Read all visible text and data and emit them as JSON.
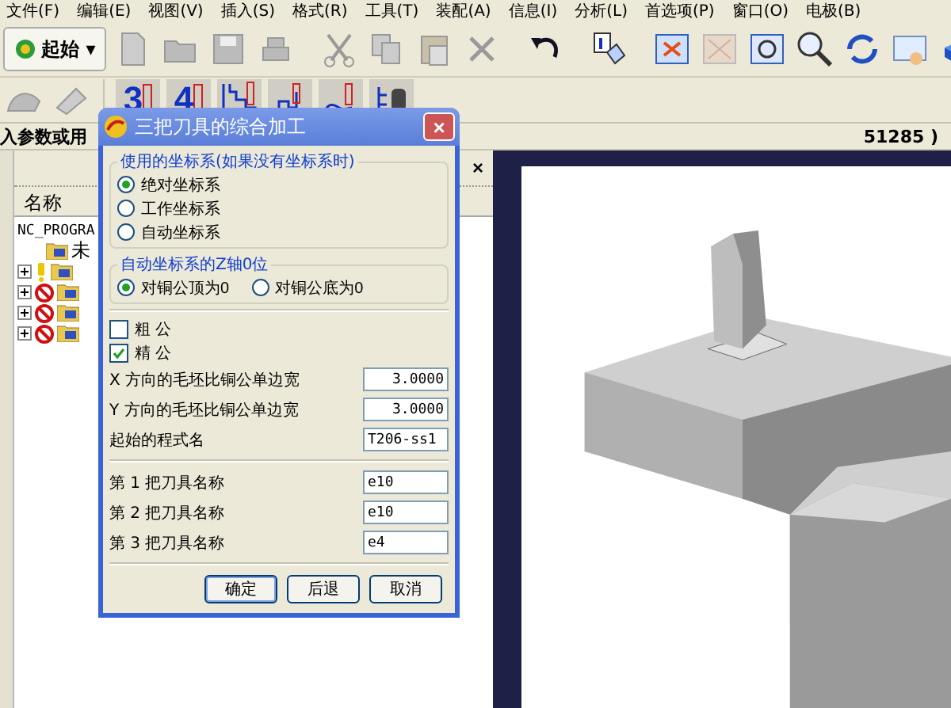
{
  "menu_bar": [
    "文件(F)",
    "编辑(E)",
    "视图(V)",
    "插入(S)",
    "格式(R)",
    "工具(T)",
    "装配(A)",
    "信息(I)",
    "分析(L)",
    "首选项(P)",
    "窗口(O)",
    "电极(B)"
  ],
  "toolbar": {
    "start_button": "起始",
    "caret": "▾"
  },
  "toolbar_2": {
    "tools": [
      {
        "kind": "digit",
        "label": "3"
      },
      {
        "kind": "digit",
        "label": "4"
      },
      {
        "kind": "steps"
      },
      {
        "kind": "pocket"
      },
      {
        "kind": "surface"
      },
      {
        "kind": "tree"
      }
    ]
  },
  "status_line": {
    "prompt": "入参数或用",
    "value": "51285 )"
  },
  "navigator": {
    "close": "×",
    "column": "名称",
    "tree": [
      {
        "label": "NC_PROGRA",
        "children": [
          {
            "label": "未",
            "kind": "plain"
          },
          {
            "kind": "warning",
            "expanded": false
          },
          {
            "kind": "blocked",
            "expanded": false
          },
          {
            "kind": "blocked",
            "expanded": false
          },
          {
            "kind": "blocked",
            "expanded": false
          }
        ]
      }
    ]
  },
  "dialog": {
    "title": "三把刀具的综合加工",
    "close": "×",
    "group_1": {
      "title": "使用的坐标系(如果没有坐标系时)",
      "options": [
        {
          "label": "绝对坐标系",
          "selected": true
        },
        {
          "label": "工作坐标系",
          "selected": false
        },
        {
          "label": "自动坐标系",
          "selected": false
        }
      ]
    },
    "group_2": {
      "title": "自动坐标系的Z轴0位",
      "options": [
        {
          "label": "对铜公顶为0",
          "selected": true
        },
        {
          "label": "对铜公底为0",
          "selected": false
        }
      ]
    },
    "checks": [
      {
        "label": "粗 公",
        "checked": false
      },
      {
        "label": "精 公",
        "checked": true
      }
    ],
    "fields": [
      {
        "label": "X 方向的毛坯比铜公单边宽",
        "value": "3.0000",
        "kind": "number"
      },
      {
        "label": "Y 方向的毛坯比铜公单边宽",
        "value": "3.0000",
        "kind": "number"
      },
      {
        "label": "起始的程式名",
        "value": "T206-ss1",
        "kind": "text"
      }
    ],
    "tools": [
      {
        "label": "第 1 把刀具名称",
        "value": "e10"
      },
      {
        "label": "第 2 把刀具名称",
        "value": "e10"
      },
      {
        "label": "第 3 把刀具名称",
        "value": "e4"
      }
    ],
    "buttons": [
      "确定",
      "后退",
      "取消"
    ]
  }
}
